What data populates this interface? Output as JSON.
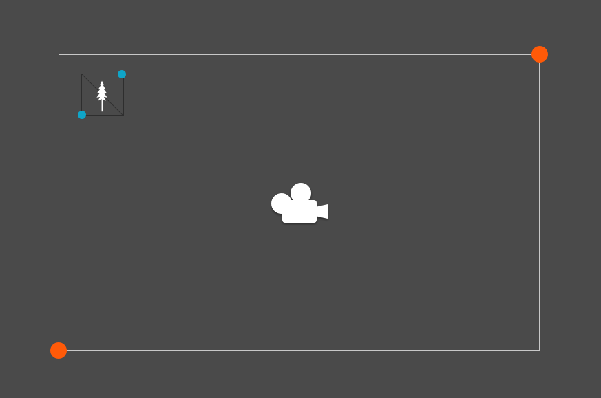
{
  "scene": {
    "background_color": "#4a4a4a",
    "frame_border_color": "#c8c8c8",
    "frame_handle_color": "#ff5a08",
    "sprite_handle_color": "#0fa5c8"
  },
  "icons": {
    "camera": "camera-icon",
    "sprite": "tree-sprite-icon",
    "frame_handles": "resize-handle",
    "sprite_handles": "resize-handle"
  }
}
